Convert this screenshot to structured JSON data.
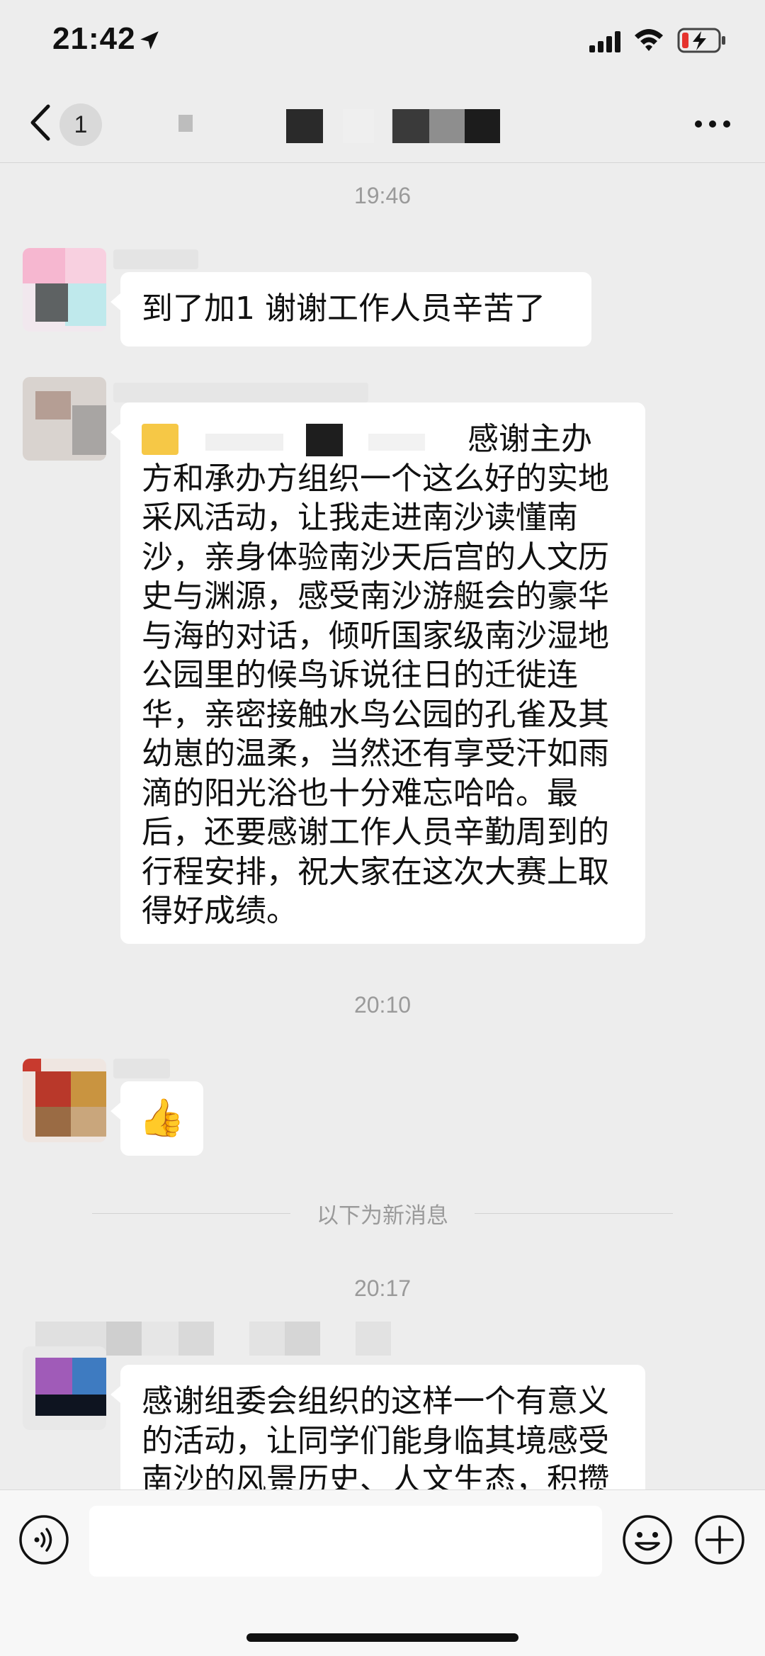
{
  "status_bar": {
    "time": "21:42"
  },
  "nav": {
    "unread_count": "1"
  },
  "messages": [
    {
      "time": "19:46",
      "text": "到了加1 谢谢工作人员辛苦了"
    },
    {
      "lines": [
        "感谢主办",
        "方和承办方组织一个这么好的实地",
        "采风活动，让我走进南沙读懂南",
        "沙，亲身体验南沙天后宫的人文历",
        "史与渊源，感受南沙游艇会的豪华",
        "与海的对话，倾听国家级南沙湿地",
        "公园里的候鸟诉说往日的迁徙连",
        "华，亲密接触水鸟公园的孔雀及其",
        "幼崽的温柔，当然还有享受汗如雨",
        "滴的阳光浴也十分难忘哈哈。最",
        "后，还要感谢工作人员辛勤周到的",
        "行程安排，祝大家在这次大赛上取",
        "得好成绩。"
      ]
    },
    {
      "time": "20:10",
      "emoji": "👍"
    },
    {
      "time": "20:17",
      "lines": [
        "感谢组委会组织的这样一个有意义",
        "的活动，让同学们能身临其境感受",
        "南沙的风景历史、人文生态，积攒"
      ]
    }
  ],
  "new_messages_divider": "以下为新消息",
  "colors": {
    "background": "#EDEDED",
    "bubble": "#FFFFFF",
    "battery_low": "#E5332E"
  }
}
